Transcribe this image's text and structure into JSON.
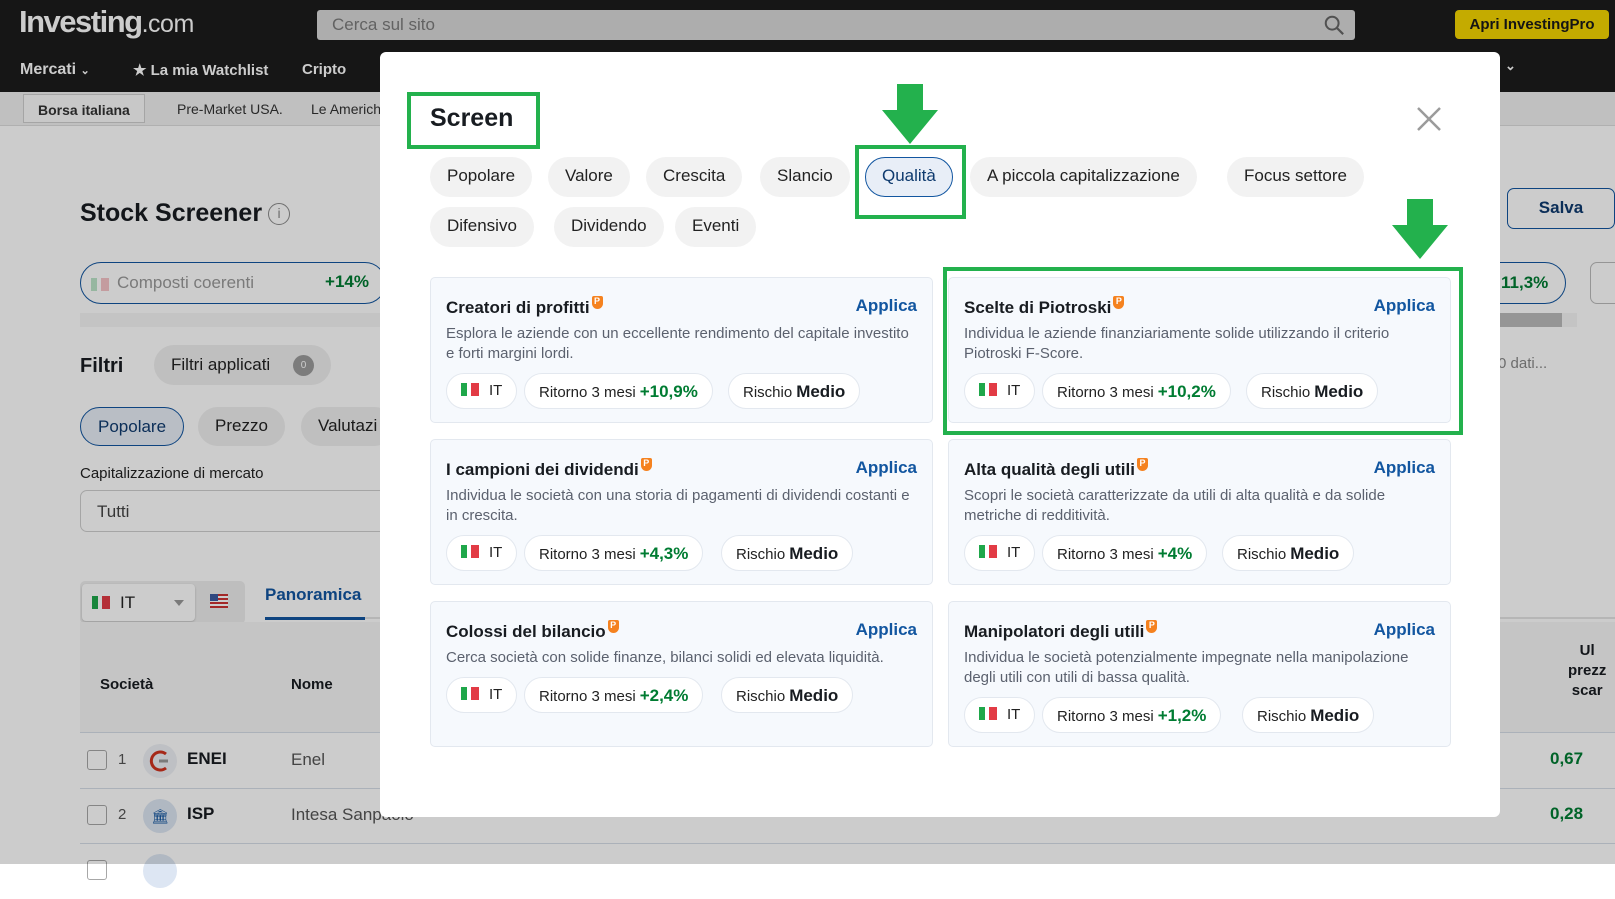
{
  "header": {
    "logo_main": "Investing",
    "logo_suffix": ".com",
    "search_placeholder": "Cerca sul sito",
    "pro_button": "Apri InvestingPro"
  },
  "nav": {
    "items": [
      "Mercati",
      "★ La mia Watchlist",
      "Cripto"
    ]
  },
  "ticker_bar": {
    "items": [
      "Borsa italiana",
      "Pre-Market USA.",
      "Le Americh"
    ]
  },
  "page": {
    "title": "Stock Screener",
    "save_button": "Salva",
    "preset_left": {
      "label": "Composti coerenti",
      "value": "+14%"
    },
    "preset_right": {
      "value": "11,3%"
    },
    "filters_label": "Filtri",
    "applied_label": "Filtri applicati",
    "applied_count": "0",
    "loading_text": "0 dati...",
    "filter_tabs": [
      "Popolare",
      "Prezzo",
      "Valutazi"
    ],
    "market_cap_label": "Capitalizzazione di mercato",
    "market_cap_value": "Tutti",
    "country": "IT",
    "view_tab": "Panoramica",
    "table": {
      "headers": [
        "Società",
        "Nome"
      ],
      "right_header_partial": [
        "Ul",
        "prezz",
        "scar"
      ],
      "rows": [
        {
          "index": "1",
          "ticker": "ENEI",
          "name": "Enel",
          "value_partial": "0,67"
        },
        {
          "index": "2",
          "ticker": "ISP",
          "name": "Intesa Sanpaolo",
          "value_partial": "0,28"
        }
      ]
    }
  },
  "modal": {
    "title": "Screen",
    "categories": [
      {
        "label": "Popolare",
        "selected": false
      },
      {
        "label": "Valore",
        "selected": false
      },
      {
        "label": "Crescita",
        "selected": false
      },
      {
        "label": "Slancio",
        "selected": false
      },
      {
        "label": "Qualità",
        "selected": true
      },
      {
        "label": "A piccola capitalizzazione",
        "selected": false
      },
      {
        "label": "Focus settore",
        "selected": false
      },
      {
        "label": "Difensivo",
        "selected": false
      },
      {
        "label": "Dividendo",
        "selected": false
      },
      {
        "label": "Eventi",
        "selected": false
      }
    ],
    "apply_label": "Applica",
    "return_label": "Ritorno 3 mesi",
    "risk_label": "Rischio",
    "pro_badge": "P",
    "cards": [
      {
        "title": "Creatori di profitti",
        "description": "Esplora le aziende con un eccellente rendimento del capitale investito e forti margini lordi.",
        "country": "IT",
        "return_3m": "+10,9%",
        "risk": "Medio"
      },
      {
        "title": "Scelte di Piotroski",
        "description": "Individua le aziende finanziariamente solide utilizzando il criterio Piotroski F-Score.",
        "country": "IT",
        "return_3m": "+10,2%",
        "risk": "Medio"
      },
      {
        "title": "I campioni dei dividendi",
        "description": "Individua le società con una storia di pagamenti di dividendi costanti e in crescita.",
        "country": "IT",
        "return_3m": "+4,3%",
        "risk": "Medio"
      },
      {
        "title": "Alta qualità degli utili",
        "description": "Scopri le società caratterizzate da utili di alta qualità e da solide metriche di redditività.",
        "country": "IT",
        "return_3m": "+4%",
        "risk": "Medio"
      },
      {
        "title": "Colossi del bilancio",
        "description": "Cerca società con solide finanze, bilanci solidi ed elevata liquidità.",
        "country": "IT",
        "return_3m": "+2,4%",
        "risk": "Medio"
      },
      {
        "title": "Manipolatori degli utili",
        "description": "Individua le società potenzialmente impegnate nella manipolazione degli utili con utili di bassa qualità.",
        "country": "IT",
        "return_3m": "+1,2%",
        "risk": "Medio"
      }
    ]
  },
  "colors": {
    "accent_blue": "#1256a0",
    "positive_green": "#007c32",
    "pro_yellow": "#f6d600",
    "pro_badge_orange": "#f5821f",
    "annotation_green": "#23b14d"
  }
}
